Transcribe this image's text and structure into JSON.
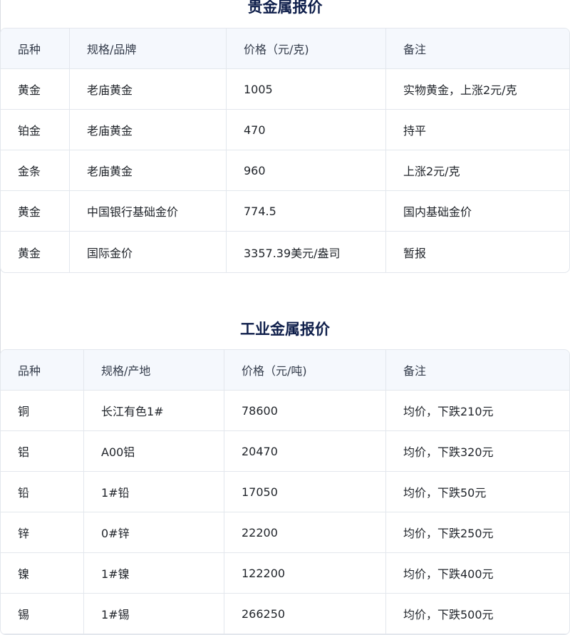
{
  "precious": {
    "title": "贵金属报价",
    "headers": [
      "品种",
      "规格/品牌",
      "价格（元/克)",
      "备注"
    ],
    "rows": [
      [
        "黄金",
        "老庙黄金",
        "1005",
        "实物黄金，上涨2元/克"
      ],
      [
        "铂金",
        "老庙黄金",
        "470",
        "持平"
      ],
      [
        "金条",
        "老庙黄金",
        "960",
        "上涨2元/克"
      ],
      [
        "黄金",
        "中国银行基础金价",
        "774.5",
        "国内基础金价"
      ],
      [
        "黄金",
        "国际金价",
        "3357.39美元/盎司",
        "暂报"
      ]
    ]
  },
  "industrial": {
    "title": "工业金属报价",
    "headers": [
      "品种",
      "规格/产地",
      "价格（元/吨)",
      "备注"
    ],
    "rows": [
      [
        "铜",
        "长江有色1#",
        "78600",
        "均价，下跌210元"
      ],
      [
        "铝",
        "A00铝",
        "20470",
        "均价，下跌320元"
      ],
      [
        "铅",
        "1#铅",
        "17050",
        "均价，下跌50元"
      ],
      [
        "锌",
        "0#锌",
        "22200",
        "均价，下跌250元"
      ],
      [
        "镍",
        "1#镍",
        "122200",
        "均价，下跌400元"
      ],
      [
        "锡",
        "1#锡",
        "266250",
        "均价，下跌500元"
      ]
    ]
  }
}
